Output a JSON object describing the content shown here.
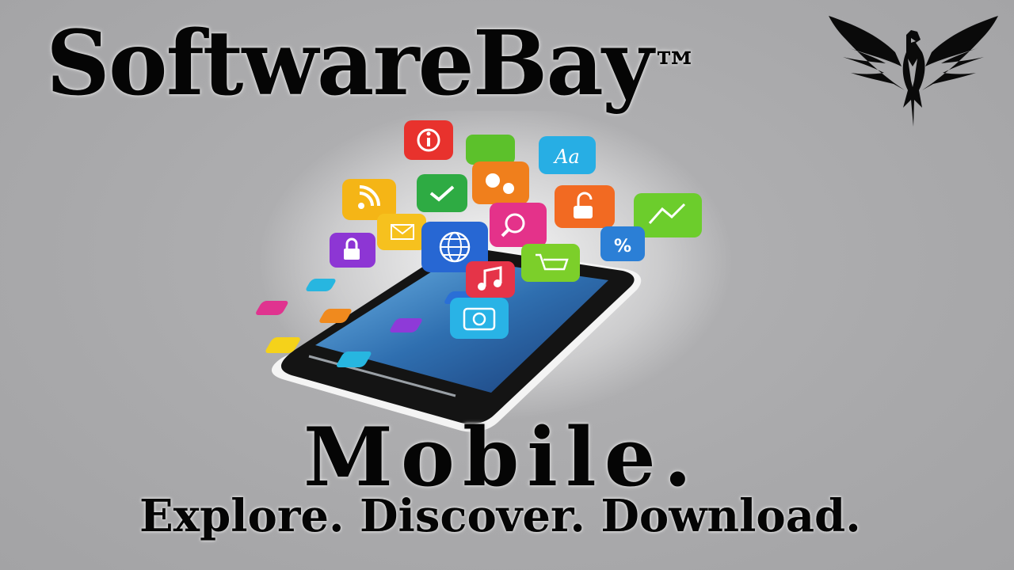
{
  "brand": {
    "name": "SoftwareBay",
    "trademark": "™"
  },
  "headline": "Mobile.",
  "slogan": "Explore. Discover. Download.",
  "icons": [
    "eagle-logo-icon",
    "info-icon",
    "grid-icon",
    "font-icon",
    "settings-icon",
    "rss-icon",
    "check-icon",
    "search-icon",
    "unlock-icon",
    "mail-icon",
    "globe-icon",
    "percent-icon",
    "chart-icon",
    "lock-icon",
    "cart-icon",
    "music-icon",
    "camera-icon"
  ],
  "colors": {
    "background": "#aaaaac",
    "text": "#050505"
  }
}
